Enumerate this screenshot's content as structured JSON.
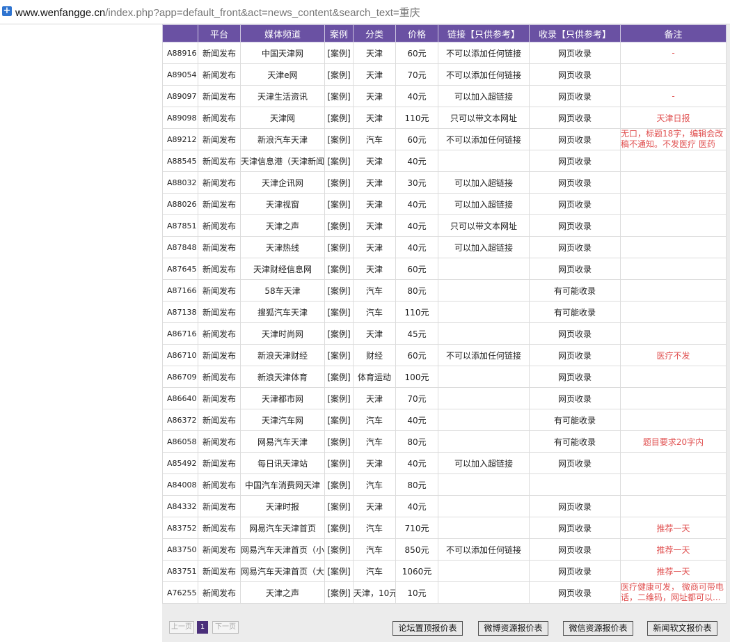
{
  "addressbar": {
    "host": "www.wenfangge.cn",
    "path": "/index.php?app=default_front&act=news_content&search_text=重庆"
  },
  "table": {
    "headers": [
      "",
      "平台",
      "媒体频道",
      "案例",
      "分类",
      "价格",
      "链接【只供参考】",
      "收录【只供参考】",
      "备注"
    ],
    "rows": [
      {
        "id": "A88916",
        "platform": "新闻发布",
        "channel": "中国天津网",
        "case": "[案例]",
        "category": "天津",
        "price": "60元",
        "link": "不可以添加任何链接",
        "index": "网页收录",
        "note": "-"
      },
      {
        "id": "A89054",
        "platform": "新闻发布",
        "channel": "天津e网",
        "case": "[案例]",
        "category": "天津",
        "price": "70元",
        "link": "不可以添加任何链接",
        "index": "网页收录",
        "note": ""
      },
      {
        "id": "A89097",
        "platform": "新闻发布",
        "channel": "天津生活资讯",
        "case": "[案例]",
        "category": "天津",
        "price": "40元",
        "link": "可以加入超链接",
        "index": "网页收录",
        "note": "-"
      },
      {
        "id": "A89098",
        "platform": "新闻发布",
        "channel": "天津网",
        "case": "[案例]",
        "category": "天津",
        "price": "110元",
        "link": "只可以带文本网址",
        "index": "网页收录",
        "note": "天津日报"
      },
      {
        "id": "A89212",
        "platform": "新闻发布",
        "channel": "新浪汽车天津",
        "case": "[案例]",
        "category": "汽车",
        "price": "60元",
        "link": "不可以添加任何链接",
        "index": "网页收录",
        "note": "无口，标题18字，编辑会改稿不通知。不发医疗 医药"
      },
      {
        "id": "A88545",
        "platform": "新闻发布",
        "channel": "天津信息港（天津新闻",
        "case": "[案例]",
        "category": "天津",
        "price": "40元",
        "link": "",
        "index": "网页收录",
        "note": ""
      },
      {
        "id": "A88032",
        "platform": "新闻发布",
        "channel": "天津企讯网",
        "case": "[案例]",
        "category": "天津",
        "price": "30元",
        "link": "可以加入超链接",
        "index": "网页收录",
        "note": ""
      },
      {
        "id": "A88026",
        "platform": "新闻发布",
        "channel": "天津视窗",
        "case": "[案例]",
        "category": "天津",
        "price": "40元",
        "link": "可以加入超链接",
        "index": "网页收录",
        "note": ""
      },
      {
        "id": "A87851",
        "platform": "新闻发布",
        "channel": "天津之声",
        "case": "[案例]",
        "category": "天津",
        "price": "40元",
        "link": "只可以带文本网址",
        "index": "网页收录",
        "note": ""
      },
      {
        "id": "A87848",
        "platform": "新闻发布",
        "channel": "天津热线",
        "case": "[案例]",
        "category": "天津",
        "price": "40元",
        "link": "可以加入超链接",
        "index": "网页收录",
        "note": ""
      },
      {
        "id": "A87645",
        "platform": "新闻发布",
        "channel": "天津财经信息网",
        "case": "[案例]",
        "category": "天津",
        "price": "60元",
        "link": "",
        "index": "网页收录",
        "note": ""
      },
      {
        "id": "A87166",
        "platform": "新闻发布",
        "channel": "58车天津",
        "case": "[案例]",
        "category": "汽车",
        "price": "80元",
        "link": "",
        "index": "有可能收录",
        "note": ""
      },
      {
        "id": "A87138",
        "platform": "新闻发布",
        "channel": "搜狐汽车天津",
        "case": "[案例]",
        "category": "汽车",
        "price": "110元",
        "link": "",
        "index": "有可能收录",
        "note": ""
      },
      {
        "id": "A86716",
        "platform": "新闻发布",
        "channel": "天津时尚网",
        "case": "[案例]",
        "category": "天津",
        "price": "45元",
        "link": "",
        "index": "网页收录",
        "note": ""
      },
      {
        "id": "A86710",
        "platform": "新闻发布",
        "channel": "新浪天津财经",
        "case": "[案例]",
        "category": "财经",
        "price": "60元",
        "link": "不可以添加任何链接",
        "index": "网页收录",
        "note": "医疗不发"
      },
      {
        "id": "A86709",
        "platform": "新闻发布",
        "channel": "新浪天津体育",
        "case": "[案例]",
        "category": "体育运动",
        "price": "100元",
        "link": "",
        "index": "网页收录",
        "note": ""
      },
      {
        "id": "A86640",
        "platform": "新闻发布",
        "channel": "天津都市网",
        "case": "[案例]",
        "category": "天津",
        "price": "70元",
        "link": "",
        "index": "网页收录",
        "note": ""
      },
      {
        "id": "A86372",
        "platform": "新闻发布",
        "channel": "天津汽车网",
        "case": "[案例]",
        "category": "汽车",
        "price": "40元",
        "link": "",
        "index": "有可能收录",
        "note": ""
      },
      {
        "id": "A86058",
        "platform": "新闻发布",
        "channel": "网易汽车天津",
        "case": "[案例]",
        "category": "汽车",
        "price": "80元",
        "link": "",
        "index": "有可能收录",
        "note": "题目要求20字内"
      },
      {
        "id": "A85492",
        "platform": "新闻发布",
        "channel": "每日讯天津站",
        "case": "[案例]",
        "category": "天津",
        "price": "40元",
        "link": "可以加入超链接",
        "index": "网页收录",
        "note": ""
      },
      {
        "id": "A84008",
        "platform": "新闻发布",
        "channel": "中国汽车消费网天津",
        "case": "[案例]",
        "category": "汽车",
        "price": "80元",
        "link": "",
        "index": "",
        "note": ""
      },
      {
        "id": "A84332",
        "platform": "新闻发布",
        "channel": "天津时报",
        "case": "[案例]",
        "category": "天津",
        "price": "40元",
        "link": "",
        "index": "网页收录",
        "note": ""
      },
      {
        "id": "A83752",
        "platform": "新闻发布",
        "channel": "网易汽车天津首页",
        "case": "[案例]",
        "category": "汽车",
        "price": "710元",
        "link": "",
        "index": "网页收录",
        "note": "推荐一天"
      },
      {
        "id": "A83750",
        "platform": "新闻发布",
        "channel": "网易汽车天津首页（小",
        "case": "[案例]",
        "category": "汽车",
        "price": "850元",
        "link": "不可以添加任何链接",
        "index": "网页收录",
        "note": "推荐一天"
      },
      {
        "id": "A83751",
        "platform": "新闻发布",
        "channel": "网易汽车天津首页（大",
        "case": "[案例]",
        "category": "汽车",
        "price": "1060元",
        "link": "",
        "index": "网页收录",
        "note": "推荐一天"
      },
      {
        "id": "A76255",
        "platform": "新闻发布",
        "channel": "天津之声",
        "case": "[案例]",
        "category": "天津，10元",
        "price": "10元",
        "link": "",
        "index": "网页收录",
        "note": "医疗健康可发， 微商可带电话，二维码，网址都可以..."
      }
    ]
  },
  "pager": {
    "prev": "上一页",
    "current": "1",
    "next": "下一页"
  },
  "buttons": [
    "论坛置顶报价表",
    "微博资源报价表",
    "微信资源报价表",
    "新闻软文报价表"
  ],
  "colors": {
    "header_bg": "#6a51a3",
    "note_text": "#e05050",
    "panel_bg": "#ececec"
  }
}
